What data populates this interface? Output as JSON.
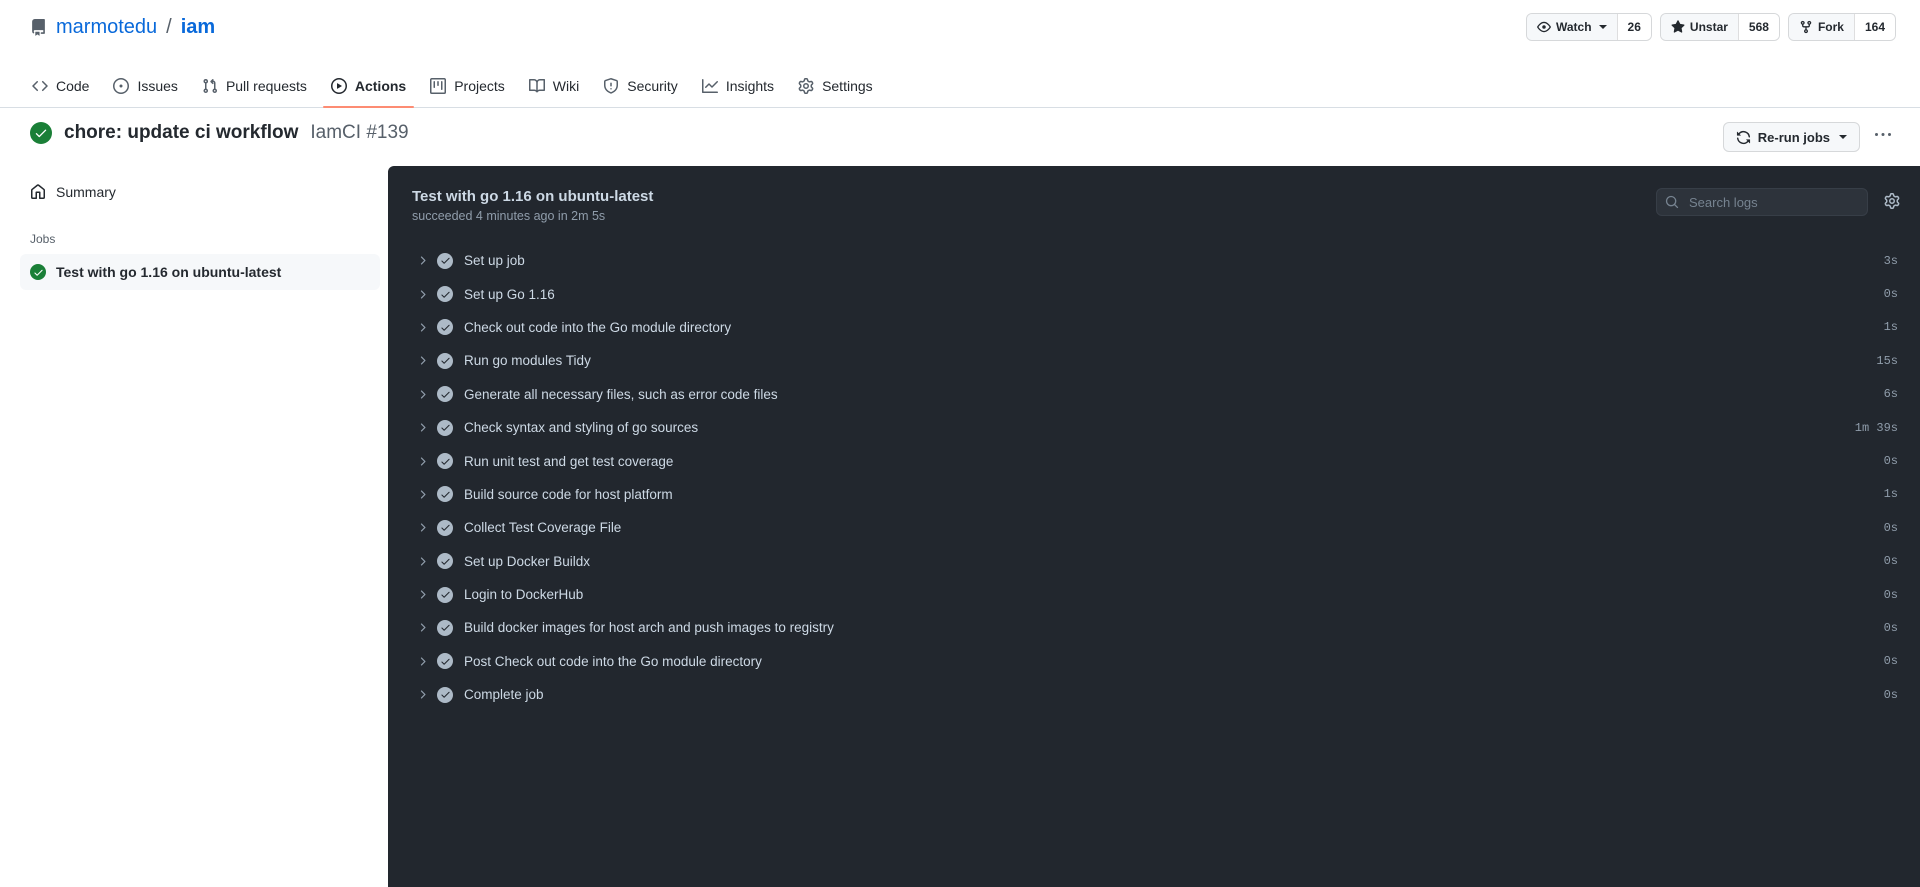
{
  "repo": {
    "owner": "marmotedu",
    "name": "iam",
    "separator": "/",
    "icon": "repo-icon"
  },
  "social": [
    {
      "label": "Watch",
      "count": "26",
      "icon": "eye-icon",
      "has_caret": true
    },
    {
      "label": "Unstar",
      "count": "568",
      "icon": "star-filled-icon",
      "has_caret": false
    },
    {
      "label": "Fork",
      "count": "164",
      "icon": "fork-icon",
      "has_caret": false
    }
  ],
  "nav": {
    "tabs": [
      {
        "label": "Code",
        "icon": "code-icon",
        "active": false
      },
      {
        "label": "Issues",
        "icon": "issue-opened-icon",
        "active": false
      },
      {
        "label": "Pull requests",
        "icon": "git-pull-request-icon",
        "active": false
      },
      {
        "label": "Actions",
        "icon": "play-icon",
        "active": true
      },
      {
        "label": "Projects",
        "icon": "project-icon",
        "active": false
      },
      {
        "label": "Wiki",
        "icon": "book-icon",
        "active": false
      },
      {
        "label": "Security",
        "icon": "shield-icon",
        "active": false
      },
      {
        "label": "Insights",
        "icon": "graph-icon",
        "active": false
      },
      {
        "label": "Settings",
        "icon": "gear-icon",
        "active": false
      }
    ]
  },
  "run": {
    "status_icon": "check-circle-icon",
    "title": "chore: update ci workflow",
    "workflow_ref": "IamCI #139",
    "rerun_label": "Re-run jobs",
    "rerun_icon": "sync-icon",
    "kebab_label": "…"
  },
  "sidebar": {
    "summary_label": "Summary",
    "summary_icon": "home-icon",
    "jobs_heading": "Jobs",
    "jobs": [
      {
        "label": "Test with go 1.16 on ubuntu-latest",
        "status": "success",
        "selected": true
      }
    ]
  },
  "log": {
    "job_title": "Test with go 1.16 on ubuntu-latest",
    "job_status_line": "succeeded 4 minutes ago in 2m 5s",
    "search_placeholder": "Search logs",
    "search_value": "",
    "search_icon": "search-icon",
    "settings_icon": "gear-icon",
    "steps": [
      {
        "name": "Set up job",
        "duration": "3s",
        "status": "success"
      },
      {
        "name": "Set up Go 1.16",
        "duration": "0s",
        "status": "success"
      },
      {
        "name": "Check out code into the Go module directory",
        "duration": "1s",
        "status": "success"
      },
      {
        "name": "Run go modules Tidy",
        "duration": "15s",
        "status": "success"
      },
      {
        "name": "Generate all necessary files, such as error code files",
        "duration": "6s",
        "status": "success"
      },
      {
        "name": "Check syntax and styling of go sources",
        "duration": "1m 39s",
        "status": "success"
      },
      {
        "name": "Run unit test and get test coverage",
        "duration": "0s",
        "status": "success"
      },
      {
        "name": "Build source code for host platform",
        "duration": "1s",
        "status": "success"
      },
      {
        "name": "Collect Test Coverage File",
        "duration": "0s",
        "status": "success"
      },
      {
        "name": "Set up Docker Buildx",
        "duration": "0s",
        "status": "success"
      },
      {
        "name": "Login to DockerHub",
        "duration": "0s",
        "status": "success"
      },
      {
        "name": "Build docker images for host arch and push images to registry",
        "duration": "0s",
        "status": "success"
      },
      {
        "name": "Post Check out code into the Go module directory",
        "duration": "0s",
        "status": "success"
      },
      {
        "name": "Complete job",
        "duration": "0s",
        "status": "success"
      }
    ]
  },
  "colors": {
    "accent": "#0969da",
    "success": "#1a7f37",
    "active_tab_underline": "#fd8c73",
    "log_bg": "#22272e"
  }
}
